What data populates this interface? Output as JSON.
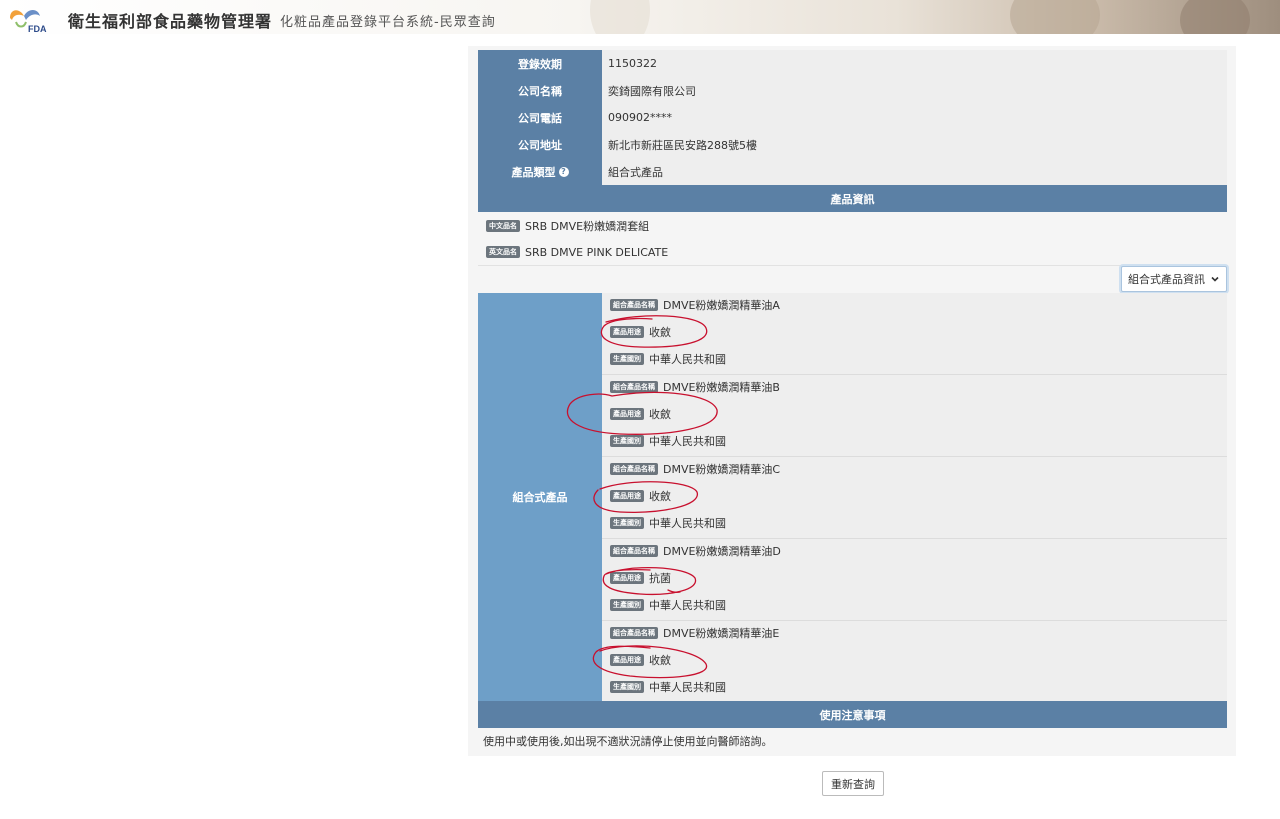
{
  "header": {
    "logo_text": "FDA",
    "agency": "衛生福利部食品藥物管理署",
    "system": "化粧品產品登錄平台系統-民眾查詢"
  },
  "details": [
    {
      "label": "登錄效期",
      "value": "1150322"
    },
    {
      "label": "公司名稱",
      "value": "奕錡國際有限公司"
    },
    {
      "label": "公司電話",
      "value": "090902****"
    },
    {
      "label": "公司地址",
      "value": "新北市新莊區民安路288號5樓"
    },
    {
      "label": "產品類型",
      "value": "組合式產品",
      "help_icon": "question-circle-icon"
    }
  ],
  "product_info": {
    "heading": "產品資訊",
    "chinese_badge": "中文品名",
    "chinese_name": "SRB DMVE粉嫩嬌潤套組",
    "english_badge": "英文品名",
    "english_name": "SRB DMVE PINK DELICATE"
  },
  "combo_dropdown": {
    "label": "組合式產品資訊",
    "icon": "chevron-down-icon"
  },
  "combo": {
    "label": "組合式產品",
    "name_badge": "組合產品名稱",
    "use_badge": "產品用途",
    "origin_badge": "生產國別",
    "items": [
      {
        "name": "DMVE粉嫩嬌潤精華油A",
        "use": "收斂",
        "origin": "中華人民共和國"
      },
      {
        "name": "DMVE粉嫩嬌潤精華油B",
        "use": "收斂",
        "origin": "中華人民共和國"
      },
      {
        "name": "DMVE粉嫩嬌潤精華油C",
        "use": "收斂",
        "origin": "中華人民共和國"
      },
      {
        "name": "DMVE粉嫩嬌潤精華油D",
        "use": "抗菌",
        "origin": "中華人民共和國"
      },
      {
        "name": "DMVE粉嫩嬌潤精華油E",
        "use": "收斂",
        "origin": "中華人民共和國"
      }
    ]
  },
  "notice": {
    "heading": "使用注意事項",
    "text": "使用中或使用後,如出現不適狀況請停止使用並向醫師諮詢。"
  },
  "requery_button": "重新查詢",
  "colors": {
    "header_blue": "#5b80a5",
    "combo_blue": "#6e9fc8",
    "annotation_red": "#c8102e"
  }
}
